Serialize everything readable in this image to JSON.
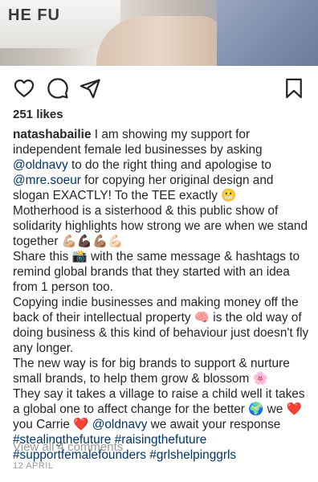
{
  "photo": {
    "shirt_text": "HE FU"
  },
  "actions": {
    "like_icon": "heart-outline",
    "comment_icon": "speech-bubble",
    "share_icon": "paper-plane",
    "save_icon": "bookmark"
  },
  "likes": "251 likes",
  "caption": {
    "username": "natashabailie",
    "p1_a": " I am showing my support for independent female led businesses by asking ",
    "mention1": "@oldnavy",
    "p1_b": " to do the right thing and apologise to ",
    "mention2": "@mre.soeur",
    "p1_c": " for copying her original design and slogan EXACTLY! To the TEE exactly 😬",
    "p2": "Motherhood is a sisterhood & this public show of solidarity highlights how strong we are when we stand together 💪🏼💪🏿💪🏽💪🏻",
    "p3": "Share this 📸 with the same message & hashtags to remind global brands that they started with an idea from 1 person too.",
    "p4": "Copying indie businesses and making money off the back of their intellectual property 🧠 is the old way of doing business & this kind of behaviour just doesn't fly any longer.",
    "p5": "The new way is for big brands to support & nurture small brands, to help them grow & blossom 🌸",
    "p6_a": "They say it takes a village to raise a child well it takes a global one to affect change for the better 🌍 we ❤️ you Carrie ❤️ ",
    "mention3": "@oldnavy",
    "p6_b": " we await your response",
    "hashtags_line1": "#stealingthefuture #raisingthefuture",
    "hashtags_line2": "#supportfemalefounders #grlshelpinggrls"
  },
  "view_all": "View all 4 comments",
  "date": "12 APRIL"
}
